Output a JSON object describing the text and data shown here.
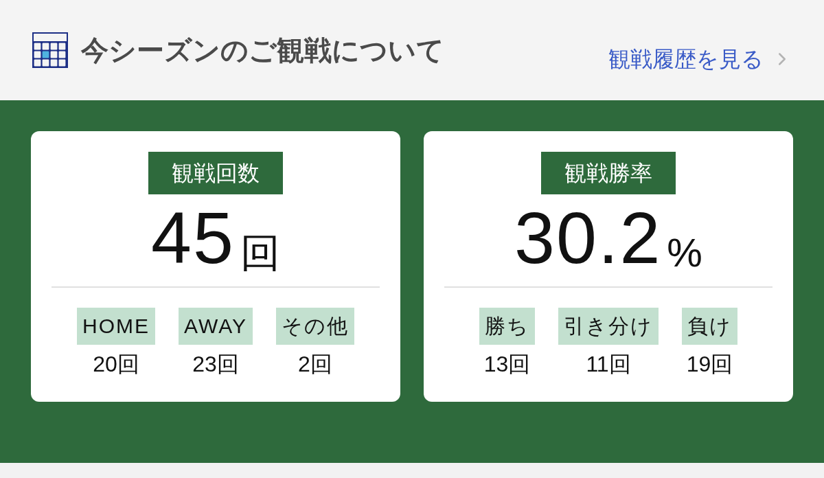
{
  "header": {
    "title": "今シーズンのご観戦について",
    "link": "観戦履歴を見る"
  },
  "cards": [
    {
      "label": "観戦回数",
      "value": "45",
      "unit": "回",
      "items": [
        {
          "label": "HOME",
          "value": "20回"
        },
        {
          "label": "AWAY",
          "value": "23回"
        },
        {
          "label": "その他",
          "value": "2回"
        }
      ]
    },
    {
      "label": "観戦勝率",
      "value": "30.2",
      "unit": "%",
      "items": [
        {
          "label": "勝ち",
          "value": "13回"
        },
        {
          "label": "引き分け",
          "value": "11回"
        },
        {
          "label": "負け",
          "value": "19回"
        }
      ]
    }
  ]
}
